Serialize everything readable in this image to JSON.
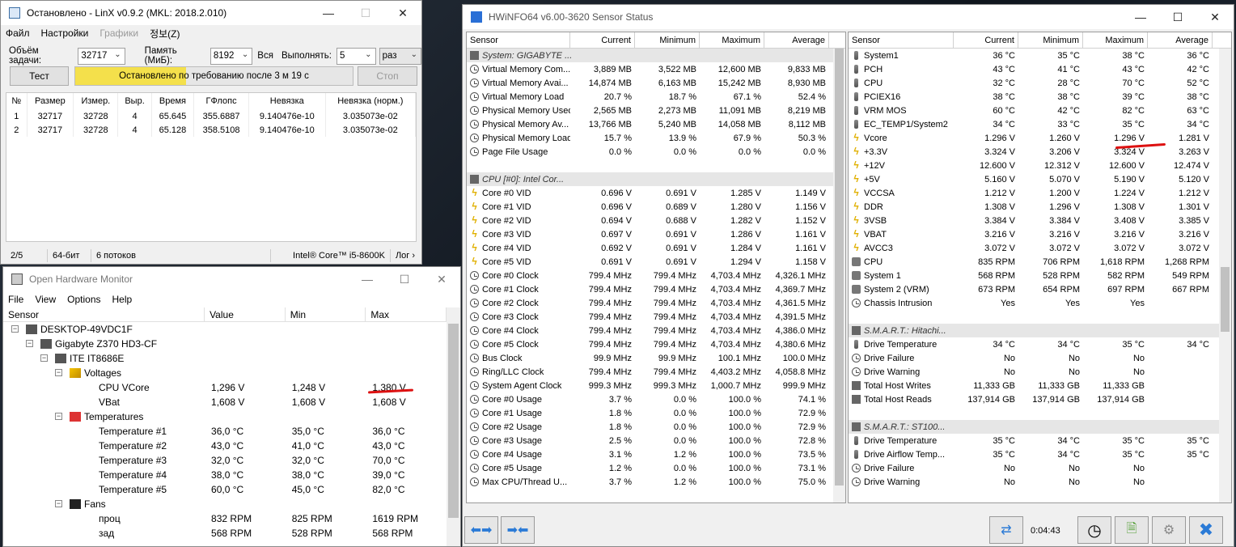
{
  "linx": {
    "title": "Остановлено - LinX v0.9.2 (MKL: 2018.2.010)",
    "menu": [
      "Файл",
      "Настройки",
      "Графики",
      "정보(Z)"
    ],
    "task_label": "Объём задачи:",
    "task_value": "32717",
    "mem_label": "Память (МиБ):",
    "mem_value": "8192",
    "all_label": "Вся",
    "run_label": "Выполнять:",
    "run_value": "5",
    "run_unit": "раз",
    "test_btn": "Тест",
    "stop_btn": "Стоп",
    "progress_text": "Остановлено по требованию после 3 м 19 с",
    "progress_fraction": 0.4,
    "columns": [
      "№",
      "Размер",
      "Измер.",
      "Выр.",
      "Время",
      "ГФлопс",
      "Невязка",
      "Невязка (норм.)"
    ],
    "rows": [
      [
        "1",
        "32717",
        "32728",
        "4",
        "65.645",
        "355.6887",
        "9.140476e-10",
        "3.035073e-02"
      ],
      [
        "2",
        "32717",
        "32728",
        "4",
        "65.128",
        "358.5108",
        "9.140476e-10",
        "3.035073e-02"
      ]
    ],
    "status": [
      "2/5",
      "64-бит",
      "6 потоков",
      "Intel® Core™ i5-8600K",
      "Лог ›"
    ]
  },
  "ohm": {
    "title": "Open Hardware Monitor",
    "menu": [
      "File",
      "View",
      "Options",
      "Help"
    ],
    "columns": [
      "Sensor",
      "Value",
      "Min",
      "Max"
    ],
    "rows": [
      {
        "name": "DESKTOP-49VDC1F",
        "value": "",
        "min": "",
        "max": "",
        "lvl": 0,
        "tog": "-",
        "icon": "computer-icon"
      },
      {
        "name": "Gigabyte Z370 HD3-CF",
        "value": "",
        "min": "",
        "max": "",
        "lvl": 1,
        "tog": "-",
        "icon": "motherboard-icon"
      },
      {
        "name": "ITE IT8686E",
        "value": "",
        "min": "",
        "max": "",
        "lvl": 2,
        "tog": "-",
        "icon": "chip-icon"
      },
      {
        "name": "Voltages",
        "value": "",
        "min": "",
        "max": "",
        "lvl": 3,
        "tog": "-",
        "icon": "voltage-icon"
      },
      {
        "name": "CPU VCore",
        "value": "1,296 V",
        "min": "1,248 V",
        "max": "1,380 V",
        "lvl": 4
      },
      {
        "name": "VBat",
        "value": "1,608 V",
        "min": "1,608 V",
        "max": "1,608 V",
        "lvl": 4
      },
      {
        "name": "Temperatures",
        "value": "",
        "min": "",
        "max": "",
        "lvl": 3,
        "tog": "-",
        "icon": "thermometer-icon"
      },
      {
        "name": "Temperature #1",
        "value": "36,0 °C",
        "min": "35,0 °C",
        "max": "36,0 °C",
        "lvl": 4
      },
      {
        "name": "Temperature #2",
        "value": "43,0 °C",
        "min": "41,0 °C",
        "max": "43,0 °C",
        "lvl": 4
      },
      {
        "name": "Temperature #3",
        "value": "32,0 °C",
        "min": "32,0 °C",
        "max": "70,0 °C",
        "lvl": 4
      },
      {
        "name": "Temperature #4",
        "value": "38,0 °C",
        "min": "38,0 °C",
        "max": "39,0 °C",
        "lvl": 4
      },
      {
        "name": "Temperature #5",
        "value": "60,0 °C",
        "min": "45,0 °C",
        "max": "82,0 °C",
        "lvl": 4
      },
      {
        "name": "Fans",
        "value": "",
        "min": "",
        "max": "",
        "lvl": 3,
        "tog": "-",
        "icon": "fan-icon"
      },
      {
        "name": "проц",
        "value": "832 RPM",
        "min": "825 RPM",
        "max": "1619 RPM",
        "lvl": 4
      },
      {
        "name": "зад",
        "value": "568 RPM",
        "min": "528 RPM",
        "max": "568 RPM",
        "lvl": 4
      }
    ]
  },
  "hw": {
    "title": "HWiNFO64 v6.00-3620 Sensor Status",
    "columns": [
      "Sensor",
      "Current",
      "Minimum",
      "Maximum",
      "Average"
    ],
    "left": [
      {
        "g": "System: GIGABYTE ..."
      },
      {
        "i": "clock",
        "n": "Virtual Memory Com...",
        "c": "3,889 MB",
        "mi": "3,522 MB",
        "ma": "12,600 MB",
        "a": "9,833 MB"
      },
      {
        "i": "clock",
        "n": "Virtual Memory Avai...",
        "c": "14,874 MB",
        "mi": "6,163 MB",
        "ma": "15,242 MB",
        "a": "8,930 MB"
      },
      {
        "i": "clock",
        "n": "Virtual Memory Load",
        "c": "20.7 %",
        "mi": "18.7 %",
        "ma": "67.1 %",
        "a": "52.4 %"
      },
      {
        "i": "clock",
        "n": "Physical Memory Used",
        "c": "2,565 MB",
        "mi": "2,273 MB",
        "ma": "11,091 MB",
        "a": "8,219 MB"
      },
      {
        "i": "clock",
        "n": "Physical Memory Av...",
        "c": "13,766 MB",
        "mi": "5,240 MB",
        "ma": "14,058 MB",
        "a": "8,112 MB"
      },
      {
        "i": "clock",
        "n": "Physical Memory Load",
        "c": "15.7 %",
        "mi": "13.9 %",
        "ma": "67.9 %",
        "a": "50.3 %"
      },
      {
        "i": "clock",
        "n": "Page File Usage",
        "c": "0.0 %",
        "mi": "0.0 %",
        "ma": "0.0 %",
        "a": "0.0 %"
      },
      {
        "sp": 1
      },
      {
        "g": "CPU [#0]: Intel Cor..."
      },
      {
        "i": "bolt",
        "n": "Core #0 VID",
        "c": "0.696 V",
        "mi": "0.691 V",
        "ma": "1.285 V",
        "a": "1.149 V"
      },
      {
        "i": "bolt",
        "n": "Core #1 VID",
        "c": "0.696 V",
        "mi": "0.689 V",
        "ma": "1.280 V",
        "a": "1.156 V"
      },
      {
        "i": "bolt",
        "n": "Core #2 VID",
        "c": "0.694 V",
        "mi": "0.688 V",
        "ma": "1.282 V",
        "a": "1.152 V"
      },
      {
        "i": "bolt",
        "n": "Core #3 VID",
        "c": "0.697 V",
        "mi": "0.691 V",
        "ma": "1.286 V",
        "a": "1.161 V"
      },
      {
        "i": "bolt",
        "n": "Core #4 VID",
        "c": "0.692 V",
        "mi": "0.691 V",
        "ma": "1.284 V",
        "a": "1.161 V"
      },
      {
        "i": "bolt",
        "n": "Core #5 VID",
        "c": "0.691 V",
        "mi": "0.691 V",
        "ma": "1.294 V",
        "a": "1.158 V"
      },
      {
        "i": "clock",
        "n": "Core #0 Clock",
        "c": "799.4 MHz",
        "mi": "799.4 MHz",
        "ma": "4,703.4 MHz",
        "a": "4,326.1 MHz"
      },
      {
        "i": "clock",
        "n": "Core #1 Clock",
        "c": "799.4 MHz",
        "mi": "799.4 MHz",
        "ma": "4,703.4 MHz",
        "a": "4,369.7 MHz"
      },
      {
        "i": "clock",
        "n": "Core #2 Clock",
        "c": "799.4 MHz",
        "mi": "799.4 MHz",
        "ma": "4,703.4 MHz",
        "a": "4,361.5 MHz"
      },
      {
        "i": "clock",
        "n": "Core #3 Clock",
        "c": "799.4 MHz",
        "mi": "799.4 MHz",
        "ma": "4,703.4 MHz",
        "a": "4,391.5 MHz"
      },
      {
        "i": "clock",
        "n": "Core #4 Clock",
        "c": "799.4 MHz",
        "mi": "799.4 MHz",
        "ma": "4,703.4 MHz",
        "a": "4,386.0 MHz"
      },
      {
        "i": "clock",
        "n": "Core #5 Clock",
        "c": "799.4 MHz",
        "mi": "799.4 MHz",
        "ma": "4,703.4 MHz",
        "a": "4,380.6 MHz"
      },
      {
        "i": "clock",
        "n": "Bus Clock",
        "c": "99.9 MHz",
        "mi": "99.9 MHz",
        "ma": "100.1 MHz",
        "a": "100.0 MHz"
      },
      {
        "i": "clock",
        "n": "Ring/LLC Clock",
        "c": "799.4 MHz",
        "mi": "799.4 MHz",
        "ma": "4,403.2 MHz",
        "a": "4,058.8 MHz"
      },
      {
        "i": "clock",
        "n": "System Agent Clock",
        "c": "999.3 MHz",
        "mi": "999.3 MHz",
        "ma": "1,000.7 MHz",
        "a": "999.9 MHz"
      },
      {
        "i": "clock",
        "n": "Core #0 Usage",
        "c": "3.7 %",
        "mi": "0.0 %",
        "ma": "100.0 %",
        "a": "74.1 %"
      },
      {
        "i": "clock",
        "n": "Core #1 Usage",
        "c": "1.8 %",
        "mi": "0.0 %",
        "ma": "100.0 %",
        "a": "72.9 %"
      },
      {
        "i": "clock",
        "n": "Core #2 Usage",
        "c": "1.8 %",
        "mi": "0.0 %",
        "ma": "100.0 %",
        "a": "72.9 %"
      },
      {
        "i": "clock",
        "n": "Core #3 Usage",
        "c": "2.5 %",
        "mi": "0.0 %",
        "ma": "100.0 %",
        "a": "72.8 %"
      },
      {
        "i": "clock",
        "n": "Core #4 Usage",
        "c": "3.1 %",
        "mi": "1.2 %",
        "ma": "100.0 %",
        "a": "73.5 %"
      },
      {
        "i": "clock",
        "n": "Core #5 Usage",
        "c": "1.2 %",
        "mi": "0.0 %",
        "ma": "100.0 %",
        "a": "73.1 %"
      },
      {
        "i": "clock",
        "n": "Max CPU/Thread U...",
        "c": "3.7 %",
        "mi": "1.2 %",
        "ma": "100.0 %",
        "a": "75.0 %"
      }
    ],
    "right": [
      {
        "i": "temp",
        "n": "System1",
        "c": "36 °C",
        "mi": "35 °C",
        "ma": "38 °C",
        "a": "36 °C"
      },
      {
        "i": "temp",
        "n": "PCH",
        "c": "43 °C",
        "mi": "41 °C",
        "ma": "43 °C",
        "a": "42 °C"
      },
      {
        "i": "temp",
        "n": "CPU",
        "c": "32 °C",
        "mi": "28 °C",
        "ma": "70 °C",
        "a": "52 °C"
      },
      {
        "i": "temp",
        "n": "PCIEX16",
        "c": "38 °C",
        "mi": "38 °C",
        "ma": "39 °C",
        "a": "38 °C"
      },
      {
        "i": "temp",
        "n": "VRM MOS",
        "c": "60 °C",
        "mi": "42 °C",
        "ma": "82 °C",
        "a": "63 °C"
      },
      {
        "i": "temp",
        "n": "EC_TEMP1/System2",
        "c": "34 °C",
        "mi": "33 °C",
        "ma": "35 °C",
        "a": "34 °C"
      },
      {
        "i": "bolt",
        "n": "Vcore",
        "c": "1.296 V",
        "mi": "1.260 V",
        "ma": "1.296 V",
        "a": "1.281 V"
      },
      {
        "i": "bolt",
        "n": "+3.3V",
        "c": "3.324 V",
        "mi": "3.206 V",
        "ma": "3.324 V",
        "a": "3.263 V"
      },
      {
        "i": "bolt",
        "n": "+12V",
        "c": "12.600 V",
        "mi": "12.312 V",
        "ma": "12.600 V",
        "a": "12.474 V"
      },
      {
        "i": "bolt",
        "n": "+5V",
        "c": "5.160 V",
        "mi": "5.070 V",
        "ma": "5.190 V",
        "a": "5.120 V"
      },
      {
        "i": "bolt",
        "n": "VCCSA",
        "c": "1.212 V",
        "mi": "1.200 V",
        "ma": "1.224 V",
        "a": "1.212 V"
      },
      {
        "i": "bolt",
        "n": "DDR",
        "c": "1.308 V",
        "mi": "1.296 V",
        "ma": "1.308 V",
        "a": "1.301 V"
      },
      {
        "i": "bolt",
        "n": "3VSB",
        "c": "3.384 V",
        "mi": "3.384 V",
        "ma": "3.408 V",
        "a": "3.385 V"
      },
      {
        "i": "bolt",
        "n": "VBAT",
        "c": "3.216 V",
        "mi": "3.216 V",
        "ma": "3.216 V",
        "a": "3.216 V"
      },
      {
        "i": "bolt",
        "n": "AVCC3",
        "c": "3.072 V",
        "mi": "3.072 V",
        "ma": "3.072 V",
        "a": "3.072 V"
      },
      {
        "i": "fan",
        "n": "CPU",
        "c": "835 RPM",
        "mi": "706 RPM",
        "ma": "1,618 RPM",
        "a": "1,268 RPM"
      },
      {
        "i": "fan",
        "n": "System 1",
        "c": "568 RPM",
        "mi": "528 RPM",
        "ma": "582 RPM",
        "a": "549 RPM"
      },
      {
        "i": "fan",
        "n": "System 2 (VRM)",
        "c": "673 RPM",
        "mi": "654 RPM",
        "ma": "697 RPM",
        "a": "667 RPM"
      },
      {
        "i": "clock",
        "n": "Chassis Intrusion",
        "c": "Yes",
        "mi": "Yes",
        "ma": "Yes",
        "a": ""
      },
      {
        "sp": 1
      },
      {
        "g": "S.M.A.R.T.: Hitachi..."
      },
      {
        "i": "temp",
        "n": "Drive Temperature",
        "c": "34 °C",
        "mi": "34 °C",
        "ma": "35 °C",
        "a": "34 °C"
      },
      {
        "i": "clock",
        "n": "Drive Failure",
        "c": "No",
        "mi": "No",
        "ma": "No",
        "a": ""
      },
      {
        "i": "clock",
        "n": "Drive Warning",
        "c": "No",
        "mi": "No",
        "ma": "No",
        "a": ""
      },
      {
        "i": "chip",
        "n": "Total Host Writes",
        "c": "11,333 GB",
        "mi": "11,333 GB",
        "ma": "11,333 GB",
        "a": ""
      },
      {
        "i": "chip",
        "n": "Total Host Reads",
        "c": "137,914 GB",
        "mi": "137,914 GB",
        "ma": "137,914 GB",
        "a": ""
      },
      {
        "sp": 1
      },
      {
        "g": "S.M.A.R.T.: ST100..."
      },
      {
        "i": "temp",
        "n": "Drive Temperature",
        "c": "35 °C",
        "mi": "34 °C",
        "ma": "35 °C",
        "a": "35 °C"
      },
      {
        "i": "temp",
        "n": "Drive Airflow Temp...",
        "c": "35 °C",
        "mi": "34 °C",
        "ma": "35 °C",
        "a": "35 °C"
      },
      {
        "i": "clock",
        "n": "Drive Failure",
        "c": "No",
        "mi": "No",
        "ma": "No",
        "a": ""
      },
      {
        "i": "clock",
        "n": "Drive Warning",
        "c": "No",
        "mi": "No",
        "ma": "No",
        "a": ""
      }
    ],
    "timer": "0:04:43"
  }
}
